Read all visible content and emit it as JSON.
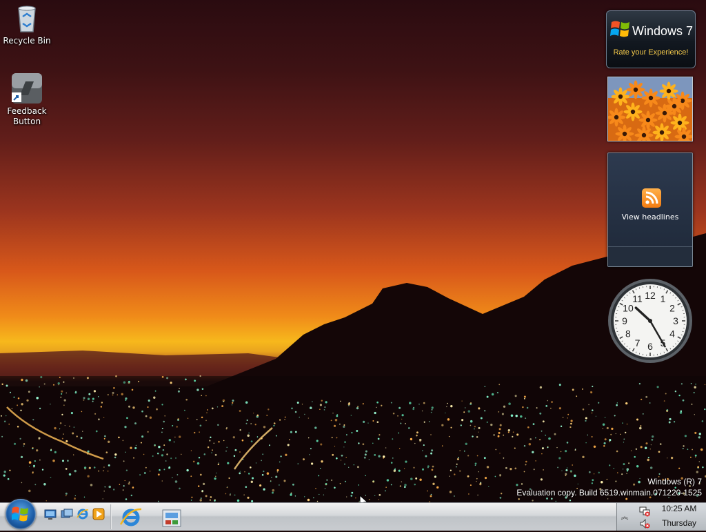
{
  "desktop": {
    "icons": [
      {
        "label": "Recycle Bin",
        "icon": "recycle-bin-icon"
      },
      {
        "label": "Feedback Button",
        "icon": "feedback-shortcut-icon"
      }
    ]
  },
  "gadgets": {
    "win7": {
      "brand": "Windows 7",
      "tagline": "Rate your Experience!"
    },
    "slideshow": {
      "icon": "slideshow-photo"
    },
    "feed": {
      "label": "View headlines",
      "icon": "rss-icon"
    },
    "clock": {
      "hour": 10,
      "minute": 25,
      "numerals": [
        "12",
        "1",
        "2",
        "3",
        "4",
        "5",
        "6",
        "7",
        "8",
        "9",
        "10",
        "11"
      ]
    }
  },
  "watermark": {
    "line1": "Windows (R) 7",
    "line2": "Evaluation copy. Build 6519.winmain.071220-1525"
  },
  "taskbar": {
    "start_icon": "windows-orb-icon",
    "quicklaunch": [
      "show-desktop-icon",
      "switch-windows-icon",
      "internet-explorer-icon",
      "media-player-icon"
    ],
    "pinned": [
      "internet-explorer-icon",
      "windows-explorer-icon"
    ],
    "tray": {
      "expand_glyph": "︽",
      "icons": [
        "network-icon",
        "volume-muted-icon"
      ],
      "time": "10:25 AM",
      "day": "Thursday"
    }
  },
  "colors": {
    "accent": "#1d5ea8",
    "gadget_text": "#f4c94a",
    "rss": "#f37c12"
  }
}
